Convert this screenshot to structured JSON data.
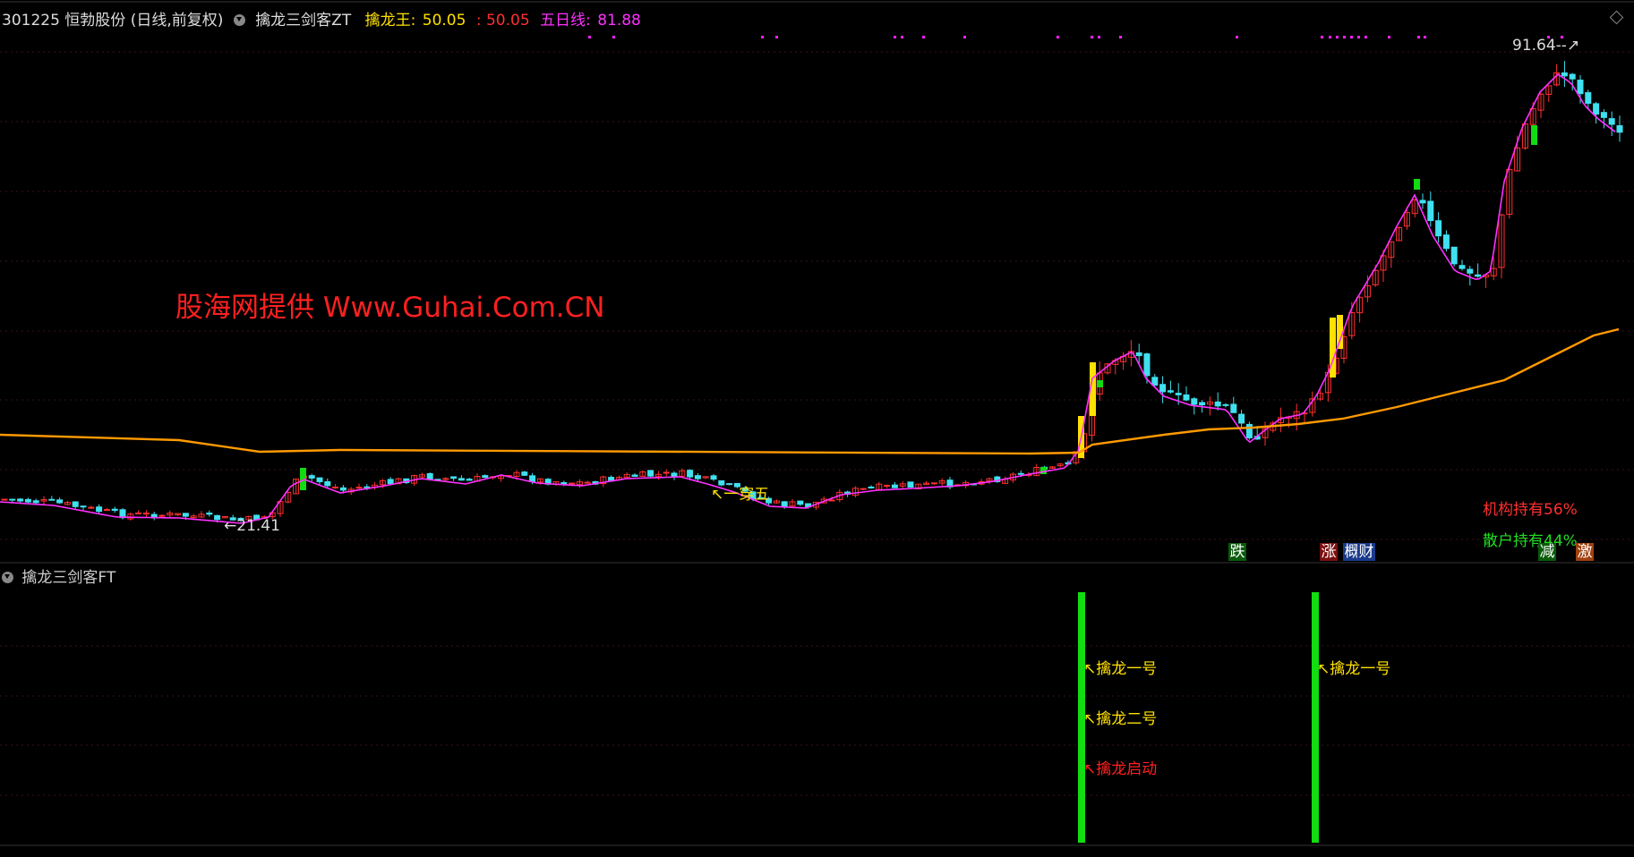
{
  "header": {
    "stock": "301225 恒勃股份 (日线,前复权)",
    "indicator": "擒龙三剑客ZT",
    "qlw_label": "擒龙王:",
    "qlw_value": "50.05",
    "sep_value": ": 50.05",
    "ma5_label": "五日线:",
    "ma5_value": "81.88"
  },
  "sub_panel": {
    "title": "擒龙三剑客FT"
  },
  "watermark": "股海网提供 Www.Guhai.Com.CN",
  "annotations": {
    "high_label": "91.64",
    "low_label": "21.41",
    "chuanwu": "一穿五",
    "inst": "机构持有56%",
    "retail": "散户持有44%",
    "badge_die": "跌",
    "badge_zhang": "涨",
    "badge_gai": "概",
    "badge_cai": "财",
    "badge_jian": "减",
    "badge_ji": "激"
  },
  "signals": [
    {
      "labels": [
        "擒龙一号",
        "擒龙二号",
        "擒龙启动"
      ]
    },
    {
      "labels": [
        "擒龙一号"
      ]
    }
  ],
  "colors": {
    "up": "#ff3030",
    "down": "#40e0f0",
    "ma5": "#ff30ff",
    "long_ma": "#ff9a00",
    "signal": "#11dd11",
    "accent_yellow": "#ffe000",
    "grid": "#3a1414",
    "magenta_dot": "#ff20ff"
  },
  "chart_data": {
    "type": "candlestick",
    "title": "301225 恒勃股份 (日线,前复权)",
    "y_range": [
      18,
      98
    ],
    "series": [
      {
        "name": "擒龙王",
        "color": "#ffe000"
      },
      {
        "name": "五日线",
        "color": "#ff30ff"
      }
    ],
    "annotated_high": 91.64,
    "annotated_low": 21.41,
    "last_values": {
      "擒龙王": 50.05,
      "五日线": 81.88
    }
  }
}
